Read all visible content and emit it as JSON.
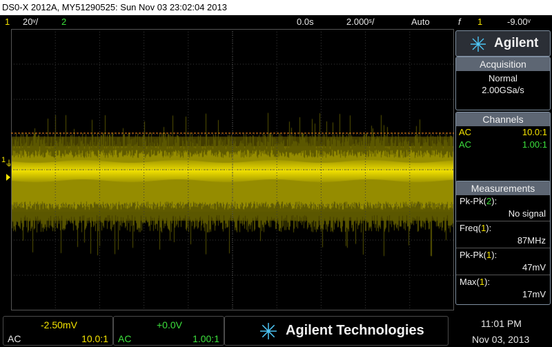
{
  "window": {
    "title": "DS0-X 2012A, MY51290525: Sun Nov 03 23:02:04 2013"
  },
  "status": {
    "ch1_num": "1",
    "ch1_scale": "20ᵛ/",
    "ch2_num": "2",
    "time_delay": "0.0s",
    "time_scale": "2.000ˢ/",
    "trigger_mode": "Auto",
    "trigger_icon": "f",
    "trigger_channel": "1",
    "trigger_level": "-9.00ᵛ"
  },
  "side": {
    "brand": "Agilent",
    "acquisition": {
      "header": "Acquisition",
      "mode": "Normal",
      "rate": "2.00GSa/s"
    },
    "channels": {
      "header": "Channels",
      "rows": [
        {
          "coupling": "AC",
          "probe": "10.0:1",
          "color": "#f5e400"
        },
        {
          "coupling": "AC",
          "probe": "1.00:1",
          "color": "#3ce03c"
        }
      ]
    },
    "measurements": {
      "header": "Measurements",
      "items": [
        {
          "label_prefix": "Pk-Pk(",
          "source": "2",
          "label_suffix": "):",
          "value": "No signal",
          "source_color": "#3ce03c"
        },
        {
          "label_prefix": "Freq(",
          "source": "1",
          "label_suffix": "):",
          "value": "87MHz",
          "source_color": "#f5e400"
        },
        {
          "label_prefix": "Pk-Pk(",
          "source": "1",
          "label_suffix": "):",
          "value": "47mV",
          "source_color": "#f5e400"
        },
        {
          "label_prefix": "Max(",
          "source": "1",
          "label_suffix": "):",
          "value": "17mV",
          "source_color": "#f5e400"
        }
      ]
    }
  },
  "bottom": {
    "ch1": {
      "offset": "-2.50mV",
      "coupling": "AC",
      "probe": "10.0:1"
    },
    "ch2": {
      "offset": "+0.0V",
      "coupling": "AC",
      "probe": "1.00:1"
    },
    "brand": "Agilent Technologies",
    "time": "11:01 PM",
    "date": "Nov 03, 2013"
  },
  "markers": {
    "ch1_marker": "1",
    "ground_marker": "⏚"
  },
  "colors": {
    "ch1": "#f5e400",
    "ch2": "#3ce03c",
    "trigger": "#ff8c1a",
    "accent": "#4cc3f2"
  }
}
